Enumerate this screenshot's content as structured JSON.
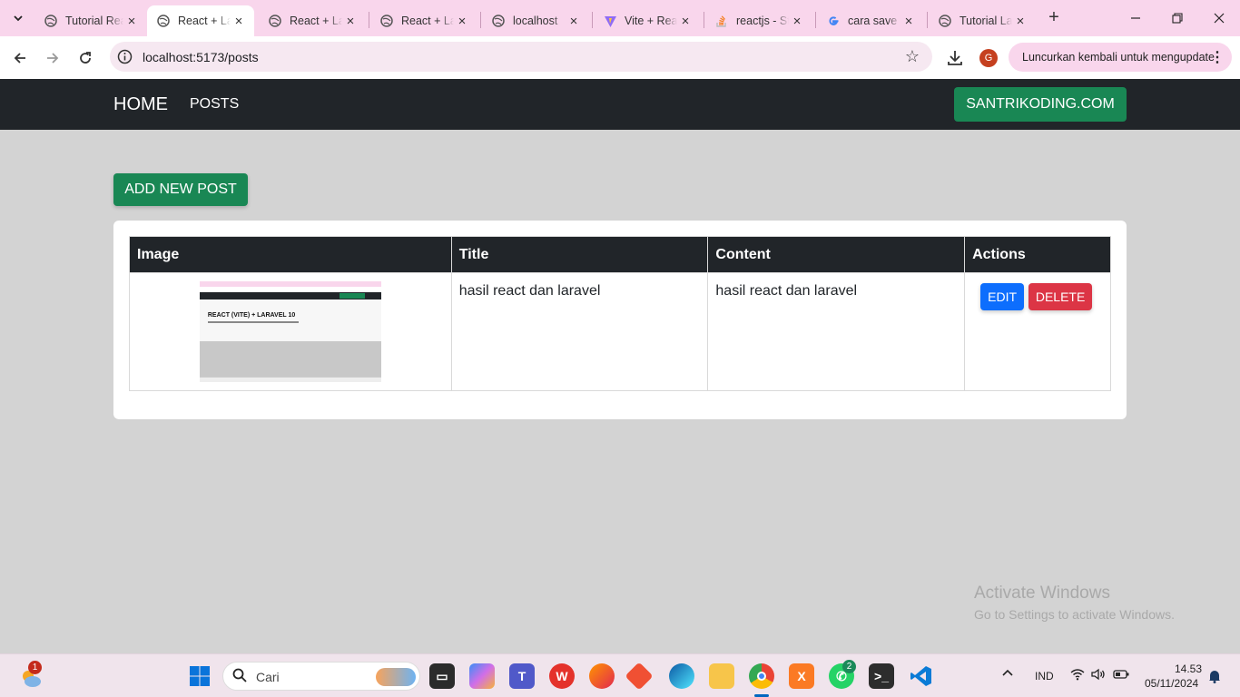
{
  "browser": {
    "tabs": [
      {
        "title": "Tutorial React",
        "favicon": "globe-icon",
        "active": false
      },
      {
        "title": "React + Laravel",
        "favicon": "globe-icon",
        "active": true
      },
      {
        "title": "React + Laravel",
        "favicon": "globe-icon",
        "active": false
      },
      {
        "title": "React + Laravel",
        "favicon": "globe-icon",
        "active": false
      },
      {
        "title": "localhost",
        "favicon": "globe-icon",
        "active": false
      },
      {
        "title": "Vite + React",
        "favicon": "vite-icon",
        "active": false
      },
      {
        "title": "reactjs - Stack Overflow",
        "favicon": "stackoverflow-icon",
        "active": false
      },
      {
        "title": "cara save",
        "favicon": "google-icon",
        "active": false
      },
      {
        "title": "Tutorial Laravel",
        "favicon": "globe-icon",
        "active": false
      }
    ],
    "new_tab_label": "+",
    "url": "localhost:5173/posts",
    "profile_initial": "G",
    "update_label": "Luncurkan kembali untuk mengupdate"
  },
  "navbar": {
    "brand": "HOME",
    "link_posts": "POSTS",
    "site_button": "SANTRIKODING.COM"
  },
  "main": {
    "add_button": "ADD NEW POST",
    "table": {
      "headers": [
        "Image",
        "Title",
        "Content",
        "Actions"
      ],
      "rows": [
        {
          "title": "hasil react dan laravel",
          "content": "hasil react dan laravel",
          "edit_label": "EDIT",
          "delete_label": "DELETE",
          "thumbnail_heading": "REACT (VITE) + LARAVEL 10"
        }
      ]
    }
  },
  "watermark": {
    "line1": "Activate Windows",
    "line2": "Go to Settings to activate Windows."
  },
  "taskbar": {
    "weather_badge": "1",
    "search_placeholder": "Cari",
    "whatsapp_badge": "2",
    "language": "IND",
    "time": "14.53",
    "date": "05/11/2024"
  },
  "colors": {
    "navbar": "#212529",
    "success": "#198754",
    "primary": "#0d6efd",
    "danger": "#dc3545",
    "page_bg": "#d3d3d3",
    "tabstrip": "#f9d6ec"
  }
}
